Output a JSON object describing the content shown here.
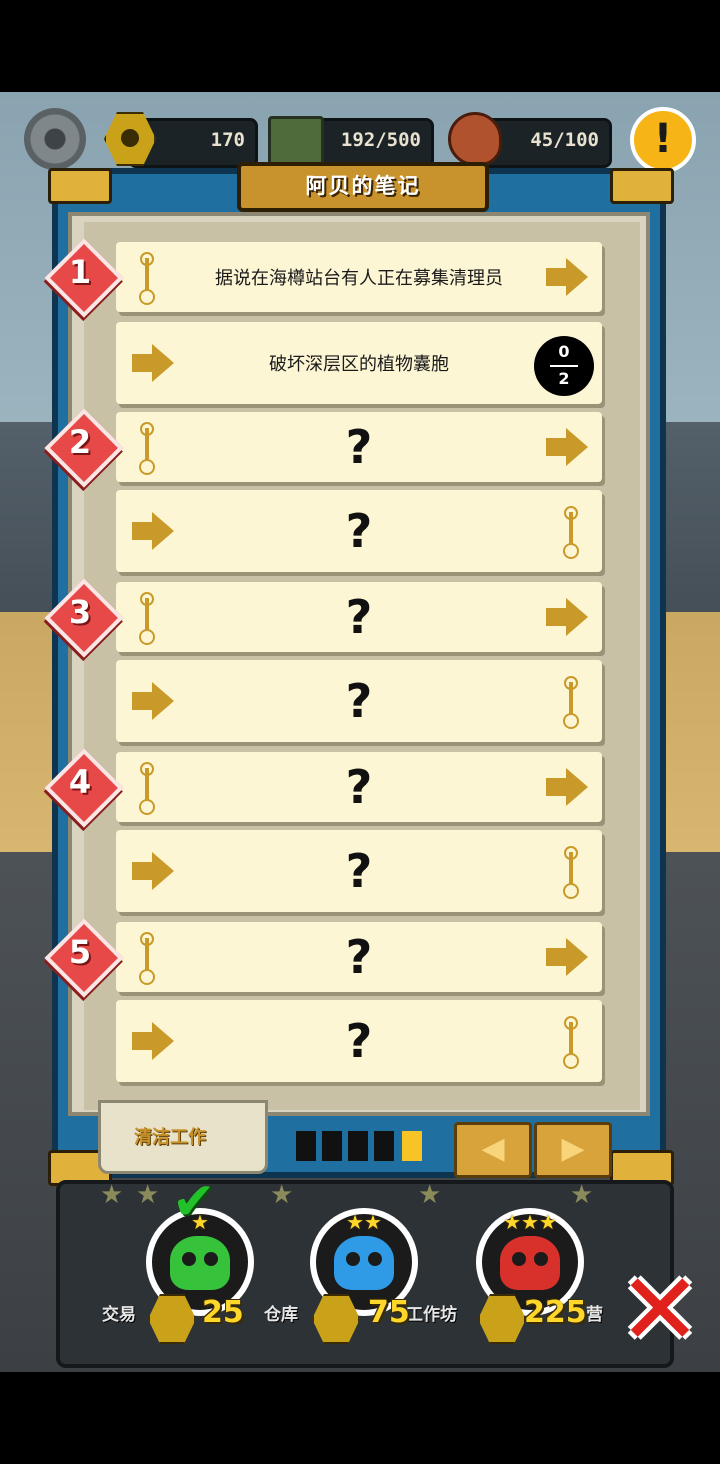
{
  "resources": {
    "nuts": "170",
    "storage": "192/500",
    "food": "45/100"
  },
  "notebook": {
    "title": "阿贝的笔记",
    "tab_label": "清洁工作",
    "rows": [
      {
        "number": "1",
        "text": "据说在海樽站台有人正在募集清理员"
      },
      {
        "text": "破坏深层区的植物囊胞",
        "progress_current": "0",
        "progress_total": "2"
      },
      {
        "number": "2",
        "text": "?"
      },
      {
        "text": "?"
      },
      {
        "number": "3",
        "text": "?"
      },
      {
        "text": "?"
      },
      {
        "number": "4",
        "text": "?"
      },
      {
        "text": "?"
      },
      {
        "number": "5",
        "text": "?"
      },
      {
        "text": "?"
      }
    ],
    "page_indicator": {
      "total": 5,
      "current": 5
    },
    "nav": {
      "prev": "◀",
      "next": "▶"
    }
  },
  "difficulty": [
    {
      "stars": "★",
      "cost": "25",
      "color": "#37c23b",
      "selected": true
    },
    {
      "stars": "★★",
      "cost": "75",
      "color": "#2f9be6"
    },
    {
      "stars": "★★★",
      "cost": "225",
      "color": "#d8312b"
    }
  ],
  "background_labels": [
    "交易",
    "仓库",
    "工作坊",
    "营"
  ],
  "icons": {
    "settings": "gear-icon",
    "alert": "!",
    "close": "✕",
    "check": "✔"
  }
}
